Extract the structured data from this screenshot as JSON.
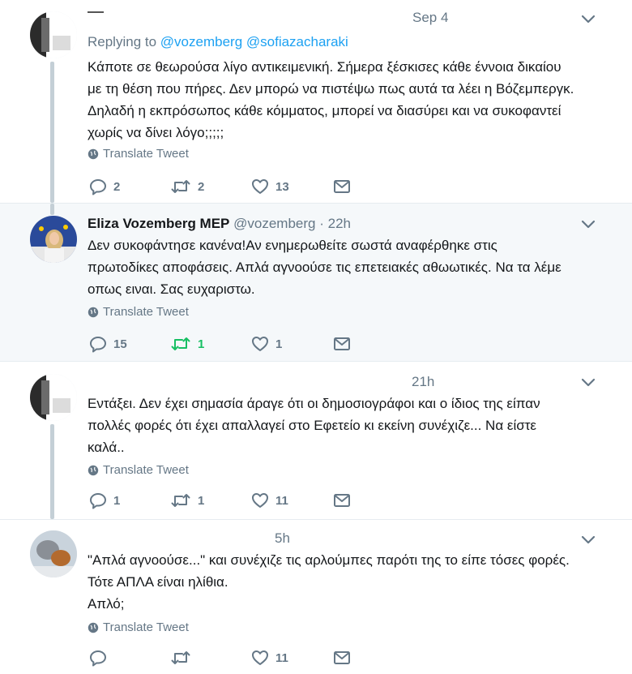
{
  "tweets": [
    {
      "date": "Sep 4",
      "replying_prefix": "Replying to",
      "replying_to": [
        "@vozemberg",
        "@sofiazacharaki"
      ],
      "text": "Κάποτε σε θεωρούσα λίγο αντικειμενική. Σήμερα ξέσκισες κάθε έννοια δικαίου\nμε τη θέση που πήρες. Δεν μπορώ να πιστέψω πως αυτά τα λέει η Βόζεμπεργκ.\nΔηλαδή η εκπρόσωπος κάθε κόμματος, μπορεί να διασύρει και να συκοφαντεί\nχωρίς να δίνει λόγο;;;;;",
      "translate": "Translate Tweet",
      "replies": "2",
      "retweets": "2",
      "likes": "13"
    },
    {
      "name": "Eliza Vozemberg MEP",
      "handle": "@vozemberg",
      "time": "· 22h",
      "text": "Δεν συκοφάντησε κανένα!Αν ενημερωθείτε σωστά αναφέρθηκε στις\nπρωτοδίκες αποφάσεις. Απλά αγνοούσε τις επετειακές αθωωτικές. Να τα λέμε\nοπως ειναι. Σας ευχαριστω.",
      "translate": "Translate Tweet",
      "replies": "15",
      "retweets": "1",
      "likes": "1"
    },
    {
      "time": "21h",
      "text": "Εντάξει. Δεν έχει σημασία άραγε ότι οι δημοσιογράφοι και ο ίδιος της είπαν\nπολλές φορές ότι έχει απαλλαγεί στο Εφετείο κι εκείνη συνέχιζε... Να είστε\nκαλά..",
      "translate": "Translate Tweet",
      "replies": "1",
      "retweets": "1",
      "likes": "11"
    },
    {
      "time": "5h",
      "text": "\"Απλά αγνοούσε...\" και συνέχιζε τις αρλούμπες παρότι της το είπε τόσες φορές.\nΤότε ΑΠΛΑ είναι ηλίθια.\nΑπλό;",
      "translate": "Translate Tweet",
      "replies": "",
      "retweets": "",
      "likes": "11"
    }
  ],
  "colors": {
    "link": "#1da1f2",
    "secondary": "#657786",
    "retweet_active": "#17bf63",
    "highlight_bg": "#f5f8fa",
    "thread_line": "#c4cfd6"
  },
  "icons": [
    "reply-icon",
    "retweet-icon",
    "like-icon",
    "message-icon",
    "globe-icon",
    "chevron-down-icon"
  ]
}
